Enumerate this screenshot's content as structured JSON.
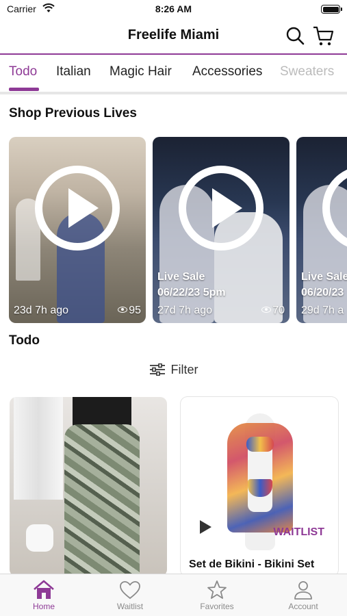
{
  "status_bar": {
    "carrier": "Carrier",
    "time": "8:26 AM"
  },
  "header": {
    "title": "Freelife Miami"
  },
  "tabs": [
    {
      "label": "Todo"
    },
    {
      "label": "Italian"
    },
    {
      "label": "Magic Hair"
    },
    {
      "label": "Accessories"
    },
    {
      "label": "Sweaters"
    }
  ],
  "previous_lives": {
    "title": "Shop Previous Lives",
    "cards": [
      {
        "caption_line1": "",
        "caption_line2": "",
        "ago": "23d 7h ago",
        "views": "95"
      },
      {
        "caption_line1": "Live Sale",
        "caption_line2": "06/22/23 5pm",
        "ago": "27d 7h ago",
        "views": "70"
      },
      {
        "caption_line1": "Live Sale",
        "caption_line2": "06/20/23",
        "ago": "29d 7h a",
        "views": ""
      }
    ]
  },
  "products_section": {
    "title": "Todo",
    "filter_label": "Filter"
  },
  "products": [
    {
      "name": "",
      "badge": ""
    },
    {
      "name": "Set de Bikini - Bikini Set",
      "badge": "WAITLIST"
    }
  ],
  "tab_bar": {
    "items": [
      {
        "label": "Home",
        "icon": "home-icon",
        "active": true
      },
      {
        "label": "Waitlist",
        "icon": "heart-icon",
        "active": false
      },
      {
        "label": "Favorites",
        "icon": "star-icon",
        "active": false
      },
      {
        "label": "Account",
        "icon": "person-icon",
        "active": false
      }
    ]
  },
  "colors": {
    "accent": "#8e3a96",
    "inactive": "#8a8a8a"
  }
}
